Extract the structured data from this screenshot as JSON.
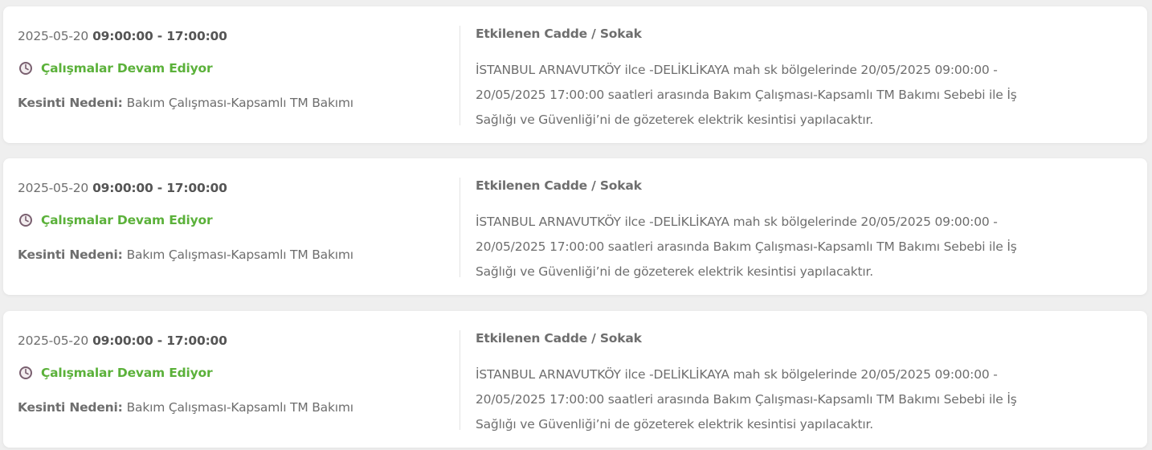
{
  "colors": {
    "status_green": "#5bb13a",
    "text_gray": "#6e6e6e",
    "background": "#efefef",
    "card": "#ffffff",
    "clock_icon": "#7a6070"
  },
  "outages": [
    {
      "date": "2025-05-20",
      "time_range": "09:00:00 - 17:00:00",
      "status_icon": "clock-icon",
      "status": "Çalışmalar Devam Ediyor",
      "reason_label": "Kesinti Nedeni:",
      "reason": "Bakım Çalışması-Kapsamlı TM Bakımı",
      "affected_title": "Etkilenen Cadde / Sokak",
      "affected_desc": "İSTANBUL ARNAVUTKÖY ilce -DELİKLİKAYA mah sk bölgelerinde 20/05/2025 09:00:00 - 20/05/2025 17:00:00 saatleri arasında Bakım Çalışması-Kapsamlı TM Bakımı Sebebi ile İş Sağlığı ve Güvenliği’ni de gözeterek elektrik kesintisi yapılacaktır."
    },
    {
      "date": "2025-05-20",
      "time_range": "09:00:00 - 17:00:00",
      "status_icon": "clock-icon",
      "status": "Çalışmalar Devam Ediyor",
      "reason_label": "Kesinti Nedeni:",
      "reason": "Bakım Çalışması-Kapsamlı TM Bakımı",
      "affected_title": "Etkilenen Cadde / Sokak",
      "affected_desc": "İSTANBUL ARNAVUTKÖY ilce -DELİKLİKAYA mah sk bölgelerinde 20/05/2025 09:00:00 - 20/05/2025 17:00:00 saatleri arasında Bakım Çalışması-Kapsamlı TM Bakımı Sebebi ile İş Sağlığı ve Güvenliği’ni de gözeterek elektrik kesintisi yapılacaktır."
    },
    {
      "date": "2025-05-20",
      "time_range": "09:00:00 - 17:00:00",
      "status_icon": "clock-icon",
      "status": "Çalışmalar Devam Ediyor",
      "reason_label": "Kesinti Nedeni:",
      "reason": "Bakım Çalışması-Kapsamlı TM Bakımı",
      "affected_title": "Etkilenen Cadde / Sokak",
      "affected_desc": "İSTANBUL ARNAVUTKÖY ilce -DELİKLİKAYA mah sk bölgelerinde 20/05/2025 09:00:00 - 20/05/2025 17:00:00 saatleri arasında Bakım Çalışması-Kapsamlı TM Bakımı Sebebi ile İş Sağlığı ve Güvenliği’ni de gözeterek elektrik kesintisi yapılacaktır."
    }
  ]
}
